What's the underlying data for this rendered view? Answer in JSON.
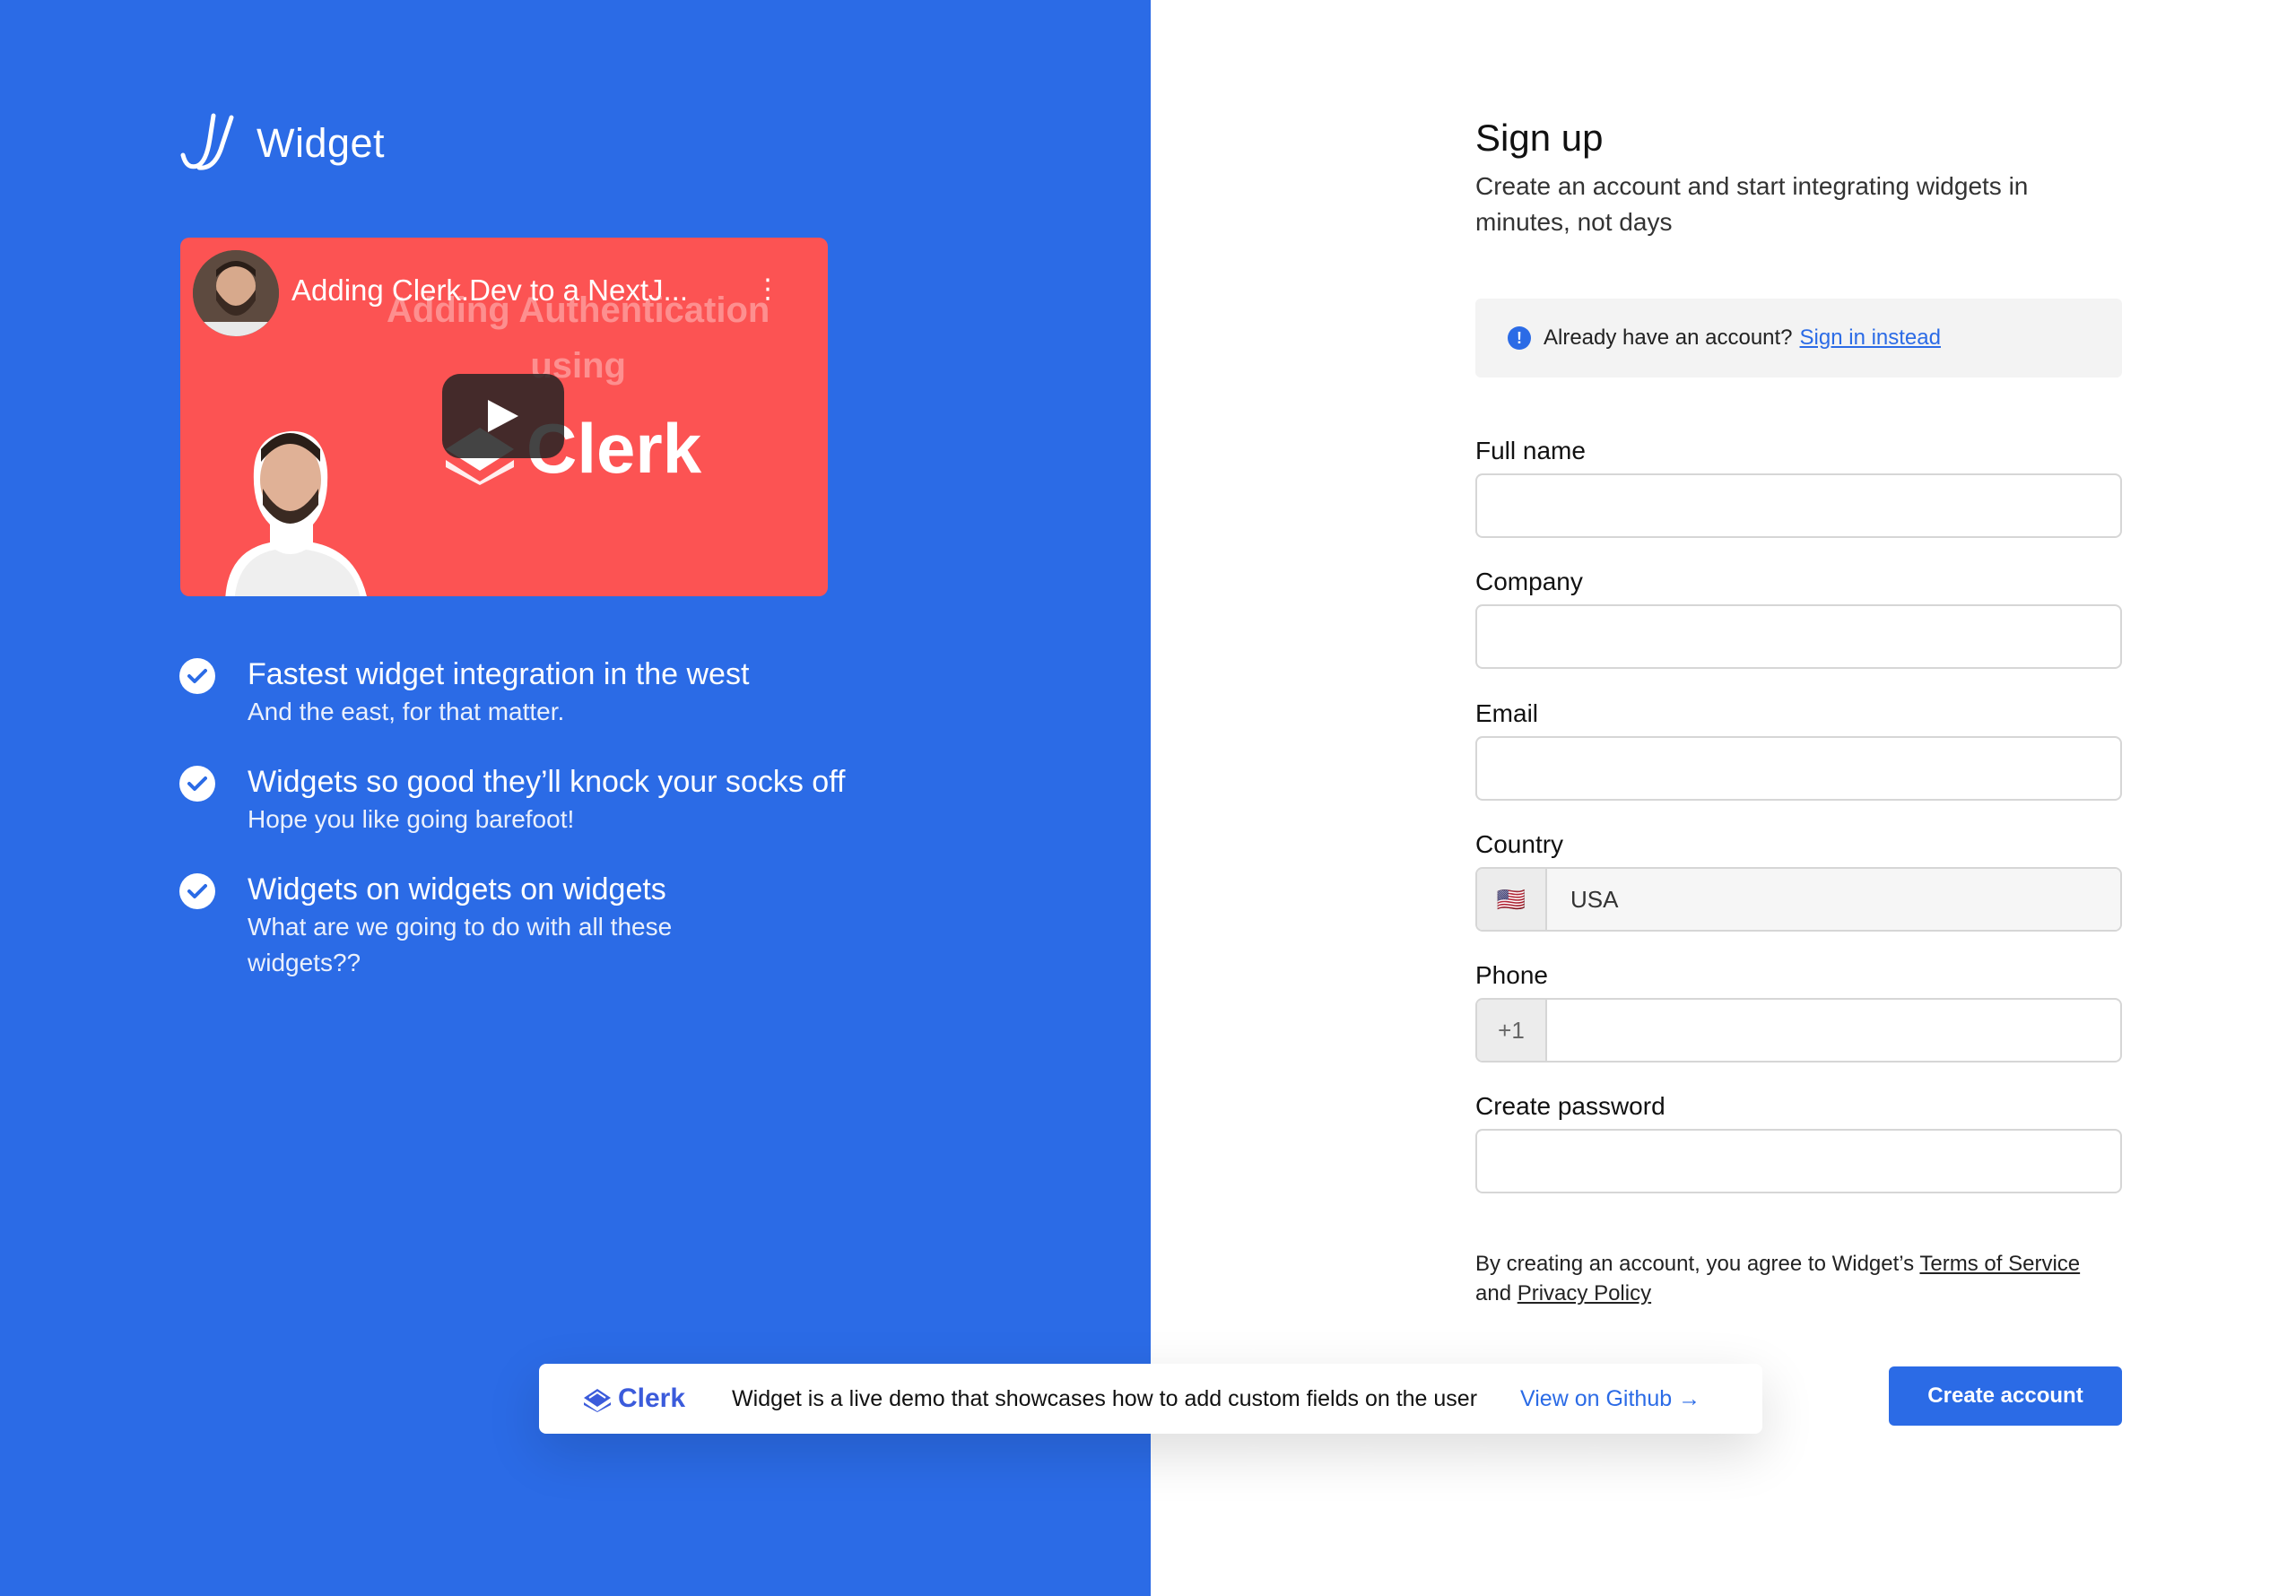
{
  "brand": {
    "name": "Widget"
  },
  "video": {
    "title": "Adding Clerk.Dev to a NextJ...",
    "overlay_line1": "Adding Authentication",
    "overlay_line2": "using",
    "brand_text": "Clerk",
    "menu": "⋮"
  },
  "features": [
    {
      "title": "Fastest widget integration in the west",
      "subtitle": "And the east, for that matter."
    },
    {
      "title": "Widgets so good they’ll knock your socks off",
      "subtitle": "Hope you like going barefoot!"
    },
    {
      "title": "Widgets on widgets on widgets",
      "subtitle": "What are we going to do with all these widgets??"
    }
  ],
  "form": {
    "title": "Sign up",
    "subtitle": "Create an account and start integrating widgets in minutes, not days",
    "notice_text": "Already have an account?",
    "notice_link": "Sign in instead",
    "fields": {
      "full_name": {
        "label": "Full name",
        "value": ""
      },
      "company": {
        "label": "Company",
        "value": ""
      },
      "email": {
        "label": "Email",
        "value": ""
      },
      "country": {
        "label": "Country",
        "flag": "🇺🇸",
        "value": "USA"
      },
      "phone": {
        "label": "Phone",
        "prefix": "+1",
        "value": ""
      },
      "password": {
        "label": "Create password",
        "value": ""
      }
    },
    "terms_prefix": "By creating an account, you agree to Widget’s",
    "terms_link": "Terms of Service",
    "terms_and": "and",
    "privacy_link": "Privacy Policy",
    "submit_label": "Create account"
  },
  "banner": {
    "brand": "Clerk",
    "message": "Widget is a live demo that showcases how to add custom fields on the user",
    "link": "View on Github →"
  },
  "colors": {
    "primary": "#2b6be6",
    "video_bg": "#fc5353",
    "clerk_brand": "#3b5bdb"
  }
}
